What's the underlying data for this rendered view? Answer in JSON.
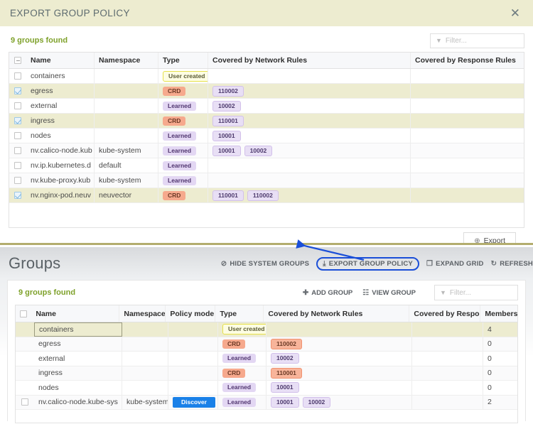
{
  "modal": {
    "title": "EXPORT GROUP POLICY",
    "close_icon": "close-icon",
    "groups_found": "9 groups found",
    "filter_placeholder": "Filter...",
    "columns": [
      "Name",
      "Namespace",
      "Type",
      "Covered by Network Rules",
      "Covered by Response Rules"
    ],
    "rows": [
      {
        "checked": false,
        "name": "containers",
        "namespace": "",
        "type": "User created",
        "type_style": "user",
        "network_rules": [],
        "response_rules": ""
      },
      {
        "checked": true,
        "name": "egress",
        "namespace": "",
        "type": "CRD",
        "type_style": "crd",
        "network_rules": [
          "110002"
        ],
        "response_rules": ""
      },
      {
        "checked": false,
        "name": "external",
        "namespace": "",
        "type": "Learned",
        "type_style": "learn",
        "network_rules": [
          "10002"
        ],
        "response_rules": ""
      },
      {
        "checked": true,
        "name": "ingress",
        "namespace": "",
        "type": "CRD",
        "type_style": "crd",
        "network_rules": [
          "110001"
        ],
        "response_rules": ""
      },
      {
        "checked": false,
        "name": "nodes",
        "namespace": "",
        "type": "Learned",
        "type_style": "learn",
        "network_rules": [
          "10001"
        ],
        "response_rules": ""
      },
      {
        "checked": false,
        "name": "nv.calico-node.kub",
        "namespace": "kube-system",
        "type": "Learned",
        "type_style": "learn",
        "network_rules": [
          "10001",
          "10002"
        ],
        "response_rules": ""
      },
      {
        "checked": false,
        "name": "nv.ip.kubernetes.d",
        "namespace": "default",
        "type": "Learned",
        "type_style": "learn",
        "network_rules": [],
        "response_rules": ""
      },
      {
        "checked": false,
        "name": "nv.kube-proxy.kub",
        "namespace": "kube-system",
        "type": "Learned",
        "type_style": "learn",
        "network_rules": [],
        "response_rules": ""
      },
      {
        "checked": true,
        "name": "nv.nginx-pod.neuv",
        "namespace": "neuvector",
        "type": "CRD",
        "type_style": "crd",
        "network_rules": [
          "110001",
          "110002"
        ],
        "response_rules": ""
      }
    ],
    "export_button": "Export",
    "export_icon": "plus-box-icon"
  },
  "page": {
    "title": "Groups",
    "actions": [
      {
        "label": "HIDE SYSTEM GROUPS",
        "icon": "eye-slash-icon",
        "highlight": false
      },
      {
        "label": "EXPORT GROUP POLICY",
        "icon": "download-icon",
        "highlight": true
      },
      {
        "label": "EXPAND GRID",
        "icon": "expand-icon",
        "highlight": false
      },
      {
        "label": "REFRESH",
        "icon": "refresh-icon",
        "highlight": false
      }
    ],
    "groups_found": "9 groups found",
    "add_group": "ADD GROUP",
    "view_group": "VIEW GROUP",
    "filter_placeholder": "Filter...",
    "columns": [
      "Name",
      "Namespace",
      "Policy mode",
      "Type",
      "Covered by Network Rules",
      "Covered by Response R...",
      "Members"
    ],
    "rows": [
      {
        "selected": true,
        "show_cb": false,
        "name": "containers",
        "namespace": "",
        "policy_mode": "",
        "type": "User created",
        "type_style": "user",
        "network_rules": [],
        "response_rules": "",
        "members": "4"
      },
      {
        "selected": false,
        "show_cb": false,
        "name": "egress",
        "namespace": "",
        "policy_mode": "",
        "type": "CRD",
        "type_style": "crd",
        "network_rules": [
          "110002"
        ],
        "response_rules": "",
        "members": "0"
      },
      {
        "selected": false,
        "show_cb": false,
        "name": "external",
        "namespace": "",
        "policy_mode": "",
        "type": "Learned",
        "type_style": "learn",
        "network_rules": [
          "10002"
        ],
        "response_rules": "",
        "members": "0"
      },
      {
        "selected": false,
        "show_cb": false,
        "name": "ingress",
        "namespace": "",
        "policy_mode": "",
        "type": "CRD",
        "type_style": "crd",
        "network_rules": [
          "110001"
        ],
        "response_rules": "",
        "members": "0"
      },
      {
        "selected": false,
        "show_cb": false,
        "name": "nodes",
        "namespace": "",
        "policy_mode": "",
        "type": "Learned",
        "type_style": "learn",
        "network_rules": [
          "10001"
        ],
        "response_rules": "",
        "members": "0"
      },
      {
        "selected": false,
        "show_cb": true,
        "name": "nv.calico-node.kube-sys",
        "namespace": "kube-system",
        "policy_mode": "Discover",
        "type": "Learned",
        "type_style": "learn",
        "network_rules": [
          "10001",
          "10002"
        ],
        "response_rules": "",
        "members": "2"
      }
    ]
  },
  "annotation": {
    "type": "arrow",
    "color": "#1b4fd8",
    "from": "export-group-policy-button",
    "to": "export-group-policy-modal"
  },
  "colors": {
    "modal_header_bg": "#edecd0",
    "selected_row_bg": "#edecd0",
    "accent_green": "#7ea12a",
    "crd_badge": "#f6a98d",
    "learned_badge": "#e3d7f3",
    "user_created_badge": "#fdfde3",
    "discover_badge": "#1a81e8",
    "annotation_blue": "#1b4fd8"
  }
}
